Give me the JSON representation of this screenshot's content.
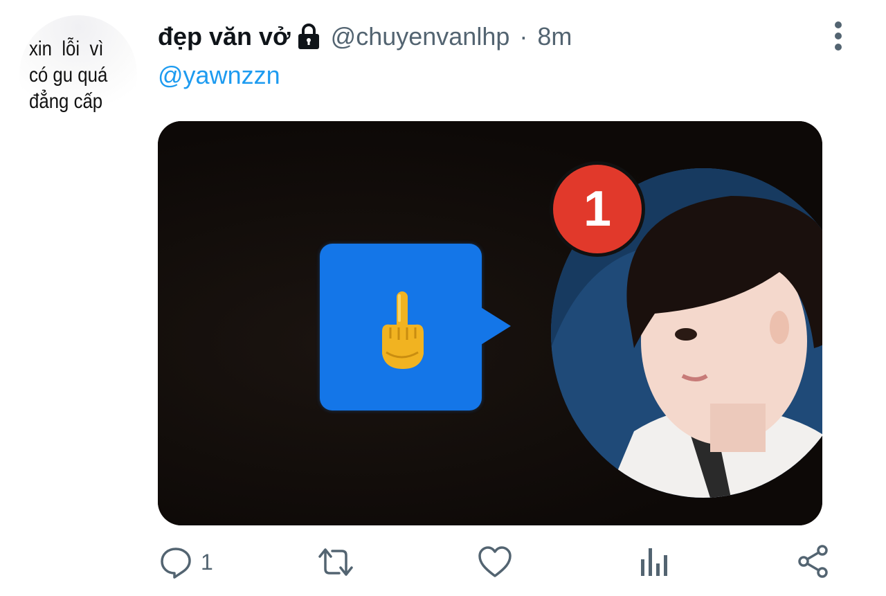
{
  "avatar": {
    "caption": "xin  lỗi  vì\ncó gu quá\nđẳng cấp"
  },
  "tweet": {
    "display_name": "đẹp văn vở",
    "handle": "@chuyenvanlhp",
    "separator": "·",
    "time": "8m",
    "mention": "@yawnzzn",
    "media": {
      "badge_count": "1",
      "emoji_icon": "middle-finger-emoji"
    },
    "reply_count": "1"
  },
  "icons": {
    "lock": "lock-icon",
    "more": "more-vertical-icon",
    "reply": "reply-icon",
    "retweet": "retweet-icon",
    "like": "heart-icon",
    "views": "views-icon",
    "share": "share-icon"
  },
  "colors": {
    "accent": "#1d9bf0",
    "secondary_text": "#536471",
    "badge": "#e1392b",
    "bubble": "#1476e8"
  }
}
